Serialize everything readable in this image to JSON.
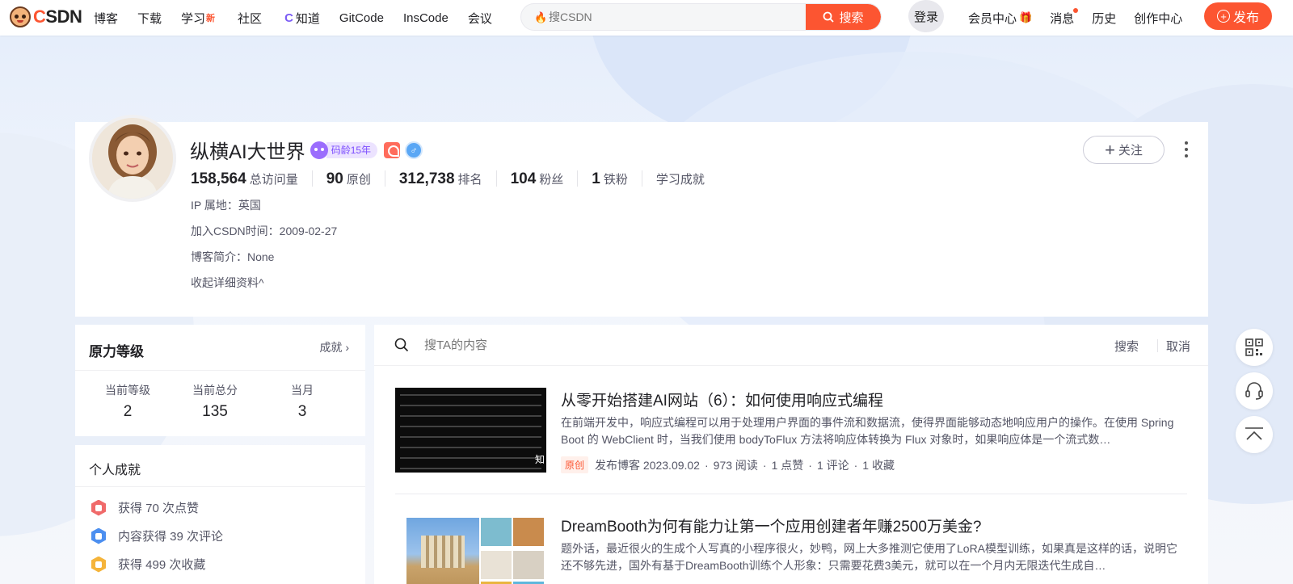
{
  "brand": {
    "logo_text_c": "C",
    "logo_text_rest": "SDN"
  },
  "nav": {
    "items": [
      {
        "label": "博客"
      },
      {
        "label": "下载"
      },
      {
        "label": "学习",
        "badge": "新"
      },
      {
        "label": "社区"
      },
      {
        "label": "知道"
      },
      {
        "label": "GitCode"
      },
      {
        "label": "InsCode"
      },
      {
        "label": "会议"
      }
    ]
  },
  "search": {
    "placeholder": "搜CSDN",
    "button": "搜索"
  },
  "header_right": {
    "login": "登录",
    "vip": "会员中心",
    "messages": "消息",
    "history": "历史",
    "creator": "创作中心",
    "publish": "发布"
  },
  "profile": {
    "name": "纵横AI大世界",
    "code_age": "码龄15年",
    "follow": "关注",
    "stats": [
      {
        "value": "158,564",
        "label": "总访问量"
      },
      {
        "value": "90",
        "label": "原创"
      },
      {
        "value": "312,738",
        "label": "排名"
      },
      {
        "value": "104",
        "label": "粉丝"
      },
      {
        "value": "1",
        "label": "铁粉"
      },
      {
        "value": "",
        "label": "学习成就"
      }
    ],
    "ip": "IP 属地：英国",
    "joined": "加入CSDN时间：2009-02-27",
    "bio": "博客简介：None",
    "collapse": "收起详细资料"
  },
  "level_card": {
    "title": "原力等级",
    "link": "成就",
    "stats": [
      {
        "label": "当前等级",
        "value": "2"
      },
      {
        "label": "当前总分",
        "value": "135"
      },
      {
        "label": "当月",
        "value": "3"
      }
    ]
  },
  "achievements": {
    "title": "个人成就",
    "items": [
      {
        "text": "获得 70 次点赞",
        "color": "#f06a6a"
      },
      {
        "text": "内容获得 39 次评论",
        "color": "#4c8ff0"
      },
      {
        "text": "获得 499 次收藏",
        "color": "#f5b43a"
      }
    ]
  },
  "content_search": {
    "placeholder": "搜TA的内容",
    "search": "搜索",
    "cancel": "取消"
  },
  "articles": [
    {
      "title": "从零开始搭建AI网站（6）：如何使用响应式编程",
      "desc": "在前端开发中，响应式编程可以用于处理用户界面的事件流和数据流，使得界面能够动态地响应用户的操作。在使用 Spring Boot 的 WebClient 时，当我们使用 bodyToFlux 方法将响应体转换为 Flux 对象时，如果响应体是一个流式数…",
      "tag": "原创",
      "date": "发布博客 2023.09.02",
      "reads": "973 阅读",
      "likes": "1 点赞",
      "comments": "1 评论",
      "favs": "1 收藏",
      "thumb_text": "知"
    },
    {
      "title": "DreamBooth为何有能力让第一个应用创建者年赚2500万美金?",
      "desc": "题外话，最近很火的生成个人写真的小程序很火，妙鸭，网上大多推测它使用了LoRA模型训练，如果真是这样的话，说明它还不够先进，国外有基于DreamBooth训练个人形象：只需要花费3美元，就可以在一个月内无限迭代生成自…"
    }
  ],
  "colors": {
    "accent": "#fc5531",
    "purple": "#7c4dff"
  }
}
